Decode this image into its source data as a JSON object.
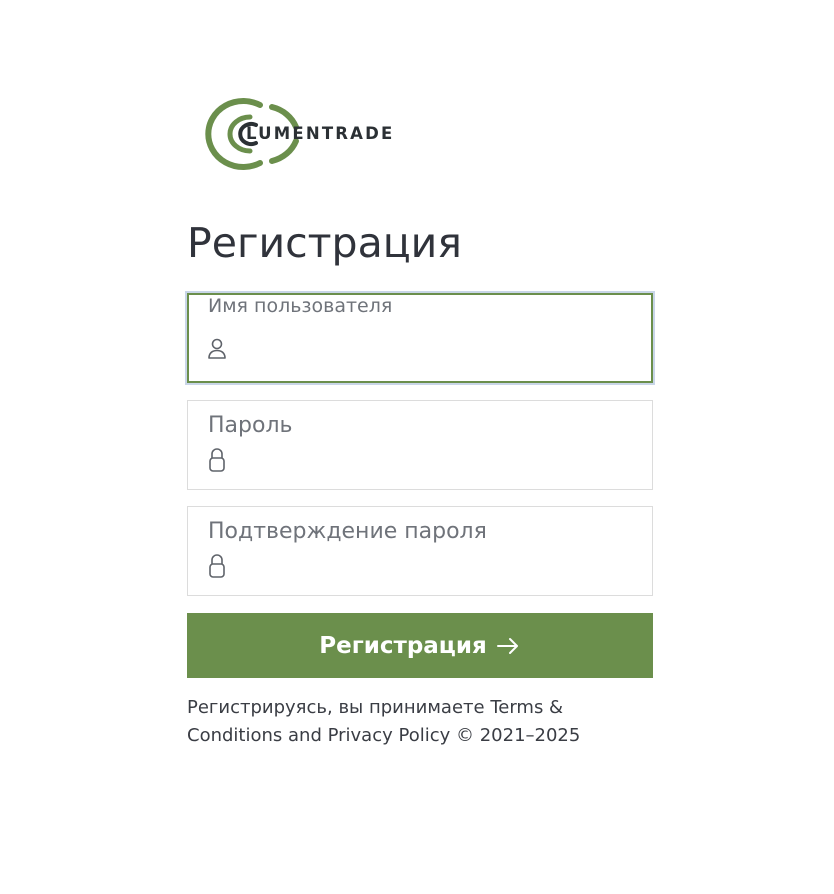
{
  "brand": {
    "name": "LUMENTRADE",
    "logo_icon": "ring-logo-icon",
    "accent_color": "#6b8f4c"
  },
  "page": {
    "title": "Регистрация"
  },
  "form": {
    "username": {
      "label": "Имя пользователя",
      "icon": "user-icon",
      "value": ""
    },
    "password": {
      "label": "Пароль",
      "icon": "lock-icon",
      "value": ""
    },
    "confirm_password": {
      "label": "Подтверждение пароля",
      "icon": "lock-icon",
      "value": ""
    },
    "submit": {
      "label": "Регистрация",
      "icon": "arrow-right-icon"
    }
  },
  "footer": {
    "prefix": "Регистрируясь, вы принимаете ",
    "terms_link": "Terms & Conditions",
    "and": " and ",
    "privacy_link": "Privacy Policy",
    "copyright": " © 2021–2025"
  }
}
